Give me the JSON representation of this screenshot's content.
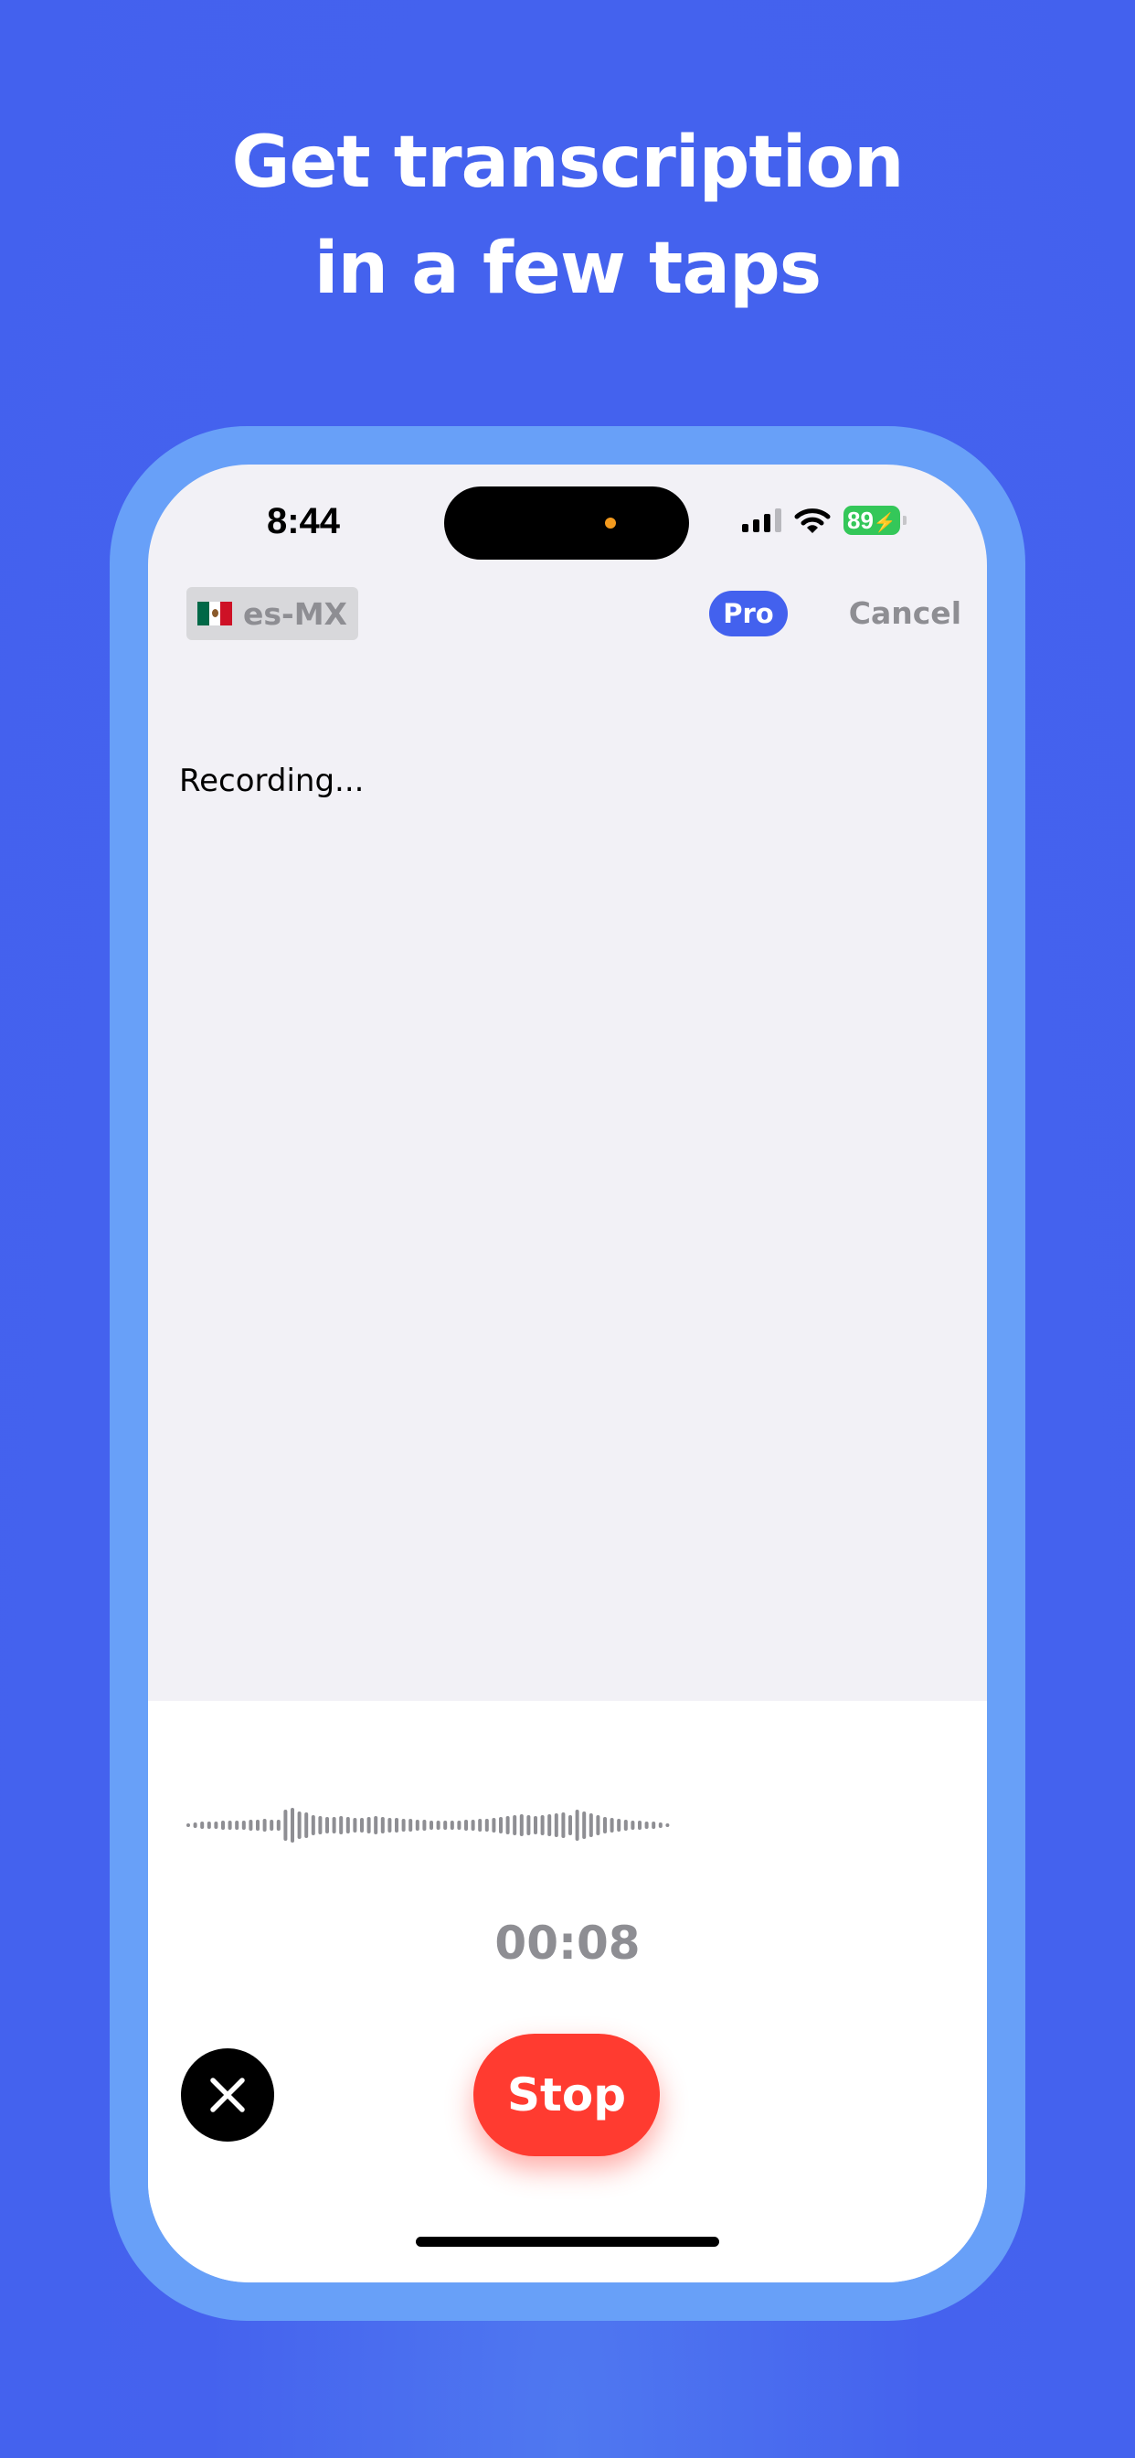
{
  "headline": {
    "line1": "Get transcription",
    "line2": "in a few taps"
  },
  "status_bar": {
    "time": "8:44",
    "battery": "89",
    "icons": [
      "cellular-signal-icon",
      "wifi-icon",
      "battery-charging-icon"
    ]
  },
  "toolbar": {
    "language": "es-MX",
    "flag_icon": "mexico-flag-icon",
    "pro_badge": "Pro",
    "cancel_label": "Cancel"
  },
  "transcript": {
    "text": "Recording..."
  },
  "recorder": {
    "timer": "00:08",
    "stop_label": "Stop",
    "discard_icon": "close-icon"
  },
  "colors": {
    "background": "#4361ee",
    "phone_frame": "#68a0f8",
    "accent": "#4361ee",
    "stop_button": "#ff3b30",
    "muted_text": "#8e8e93"
  }
}
